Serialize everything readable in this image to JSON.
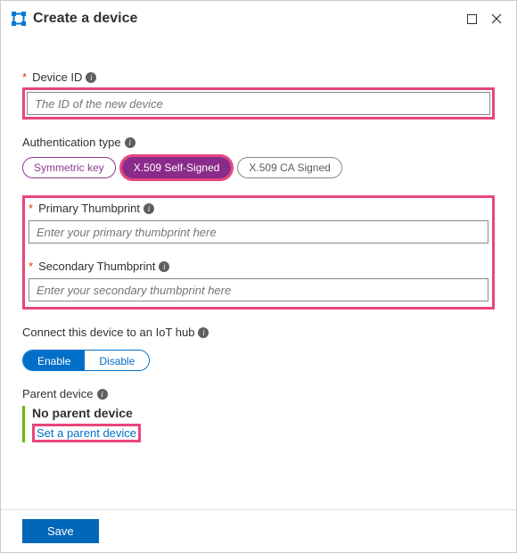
{
  "header": {
    "title": "Create a device"
  },
  "device": {
    "label": "Device ID",
    "placeholder": "The ID of the new device"
  },
  "auth": {
    "label": "Authentication type",
    "opts": {
      "sym": "Symmetric key",
      "x509ss": "X.509 Self-Signed",
      "x509ca": "X.509 CA Signed"
    }
  },
  "thumbs": {
    "primary_label": "Primary Thumbprint",
    "primary_placeholder": "Enter your primary thumbprint here",
    "secondary_label": "Secondary Thumbprint",
    "secondary_placeholder": "Enter your secondary thumbprint here"
  },
  "connect": {
    "label": "Connect this device to an IoT hub",
    "enable": "Enable",
    "disable": "Disable"
  },
  "parent": {
    "label": "Parent device",
    "none": "No parent device",
    "set_link": "Set a parent device"
  },
  "footer": {
    "save": "Save"
  }
}
